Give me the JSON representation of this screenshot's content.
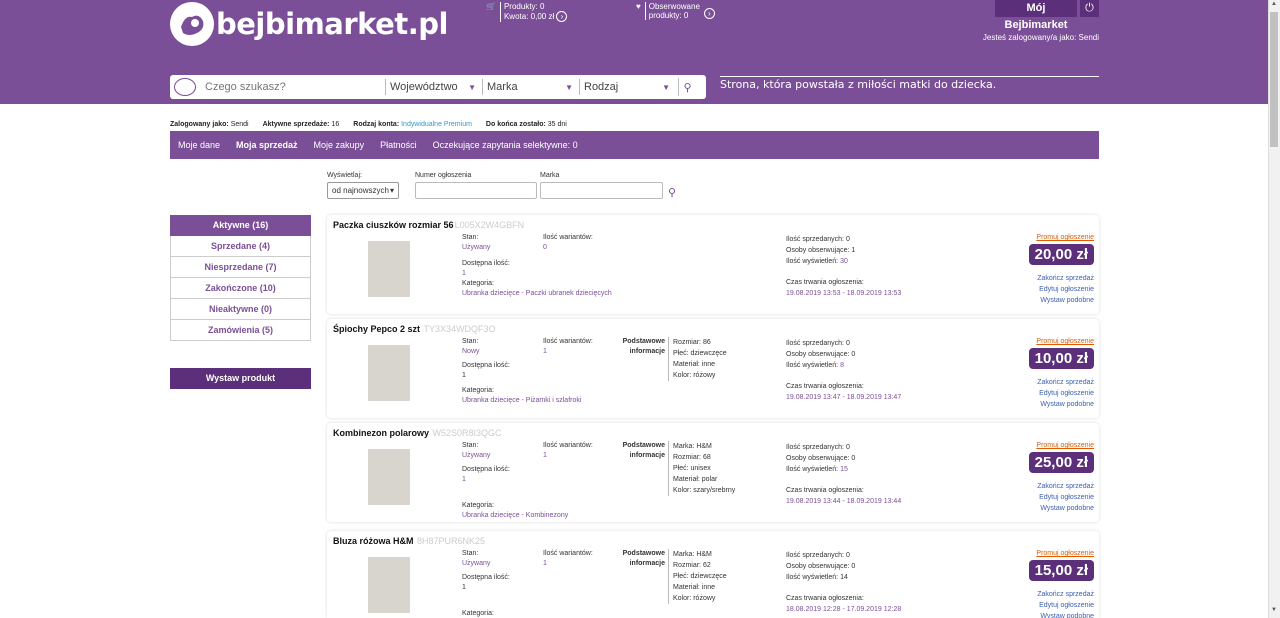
{
  "header": {
    "logo_text": "bejbimarket.pl",
    "cart_products": "Produkty: 0",
    "cart_amount": "Kwota: 0,00 zł",
    "watch_line1": "Obserwowane",
    "watch_line2": "produkty: 0",
    "my_button": "Mój Bejbimarket",
    "logged_as": "Jesteś zalogowany/a jako: Sendi",
    "slogan": "Strona, która powstała z miłości matki do dziecka."
  },
  "search": {
    "placeholder": "Czego szukasz?",
    "region": "Województwo",
    "brand": "Marka",
    "kind": "Rodzaj"
  },
  "status": {
    "logged_label": "Zalogowany jako:",
    "logged_value": "Sendi",
    "active_label": "Aktywne sprzedaże:",
    "active_value": "16",
    "account_label": "Rodzaj konta:",
    "account_value": "Indywidualne Premium",
    "left_label": "Do końca zostało:",
    "left_value": "35 dni"
  },
  "menu": [
    "Moje dane",
    "Moja sprzedaż",
    "Moje zakupy",
    "Płatności",
    "Oczekujące zapytania selektywne: 0"
  ],
  "filters": {
    "show_label": "Wyświetlaj:",
    "show_value": "od najnowszych",
    "number_label": "Numer ogłoszenia",
    "brand_label": "Marka"
  },
  "sidebar": [
    "Aktywne (16)",
    "Sprzedane (4)",
    "Niesprzedane (7)",
    "Zakończone (10)",
    "Nieaktywne (0)",
    "Zamówienia (5)"
  ],
  "post_button": "Wystaw produkt",
  "labels": {
    "state": "Stan:",
    "variants": "Ilość wariantów:",
    "available": "Dostępna ilość:",
    "category": "Kategoria:",
    "basic_info_1": "Podstawowe",
    "basic_info_2": "informacje",
    "sold": "Ilość sprzedanych:",
    "watchers": "Osoby obserwujące:",
    "views": "Ilość wyświetleń:",
    "duration": "Czas trwania ogłoszenia:",
    "promo": "Promuj ogłoszenie",
    "end": "Zakończ sprzedaż",
    "edit": "Edytuj ogłoszenie",
    "similar": "Wystaw podobne"
  },
  "listings": [
    {
      "title": "Paczka ciuszków rozmiar 56",
      "code": "L005X2W4GBFN",
      "state": "Używany",
      "variants": "0",
      "available": "1",
      "category": "Ubranka dziecięce - Paczki ubranek dziecięcych",
      "attrs": [],
      "sold": "0",
      "watchers": "1",
      "views": "30",
      "duration": "19.08.2019 13:53 - 18.09.2019 13:53",
      "price": "20,00 zł"
    },
    {
      "title": "Śpiochy Pepco 2 szt",
      "code": "TY3X34WDQF3O",
      "state": "Nowy",
      "variants": "1",
      "available": "1",
      "category": "Ubranka dziecięce - Piżamki i szlafroki",
      "attrs": [
        "Rozmiar: 86",
        "Płeć: dziewczęce",
        "Materiał: inne",
        "Kolor: różowy"
      ],
      "sold": "0",
      "watchers": "0",
      "views": "8",
      "duration": "19.08.2019 13:47 - 18.09.2019 13:47",
      "price": "10,00 zł"
    },
    {
      "title": "Kombinezon polarowy",
      "code": "W52S0R8I3QGC",
      "state": "Używany",
      "variants": "1",
      "available": "1",
      "category": "Ubranka dziecięce - Kombinezony",
      "attrs": [
        "Marka: H&M",
        "Rozmiar: 68",
        "Płeć: unisex",
        "Materiał: polar",
        "Kolor: szary/srebrny"
      ],
      "sold": "0",
      "watchers": "0",
      "views": "15",
      "duration": "19.08.2019 13:44 - 18.09.2019 13:44",
      "price": "25,00 zł"
    },
    {
      "title": "Bluza różowa H&M",
      "code": "8H87PUR6NK25",
      "state": "Używany",
      "variants": "1",
      "available": "1",
      "category": "",
      "attrs": [
        "Marka: H&M",
        "Rozmiar: 62",
        "Płeć: dziewczęce",
        "Materiał: inne",
        "Kolor: różowy"
      ],
      "sold": "0",
      "watchers": "0",
      "views": "14",
      "duration": "18.08.2019 12:28 - 17.09.2019 12:28",
      "price": "15,00 zł"
    }
  ]
}
